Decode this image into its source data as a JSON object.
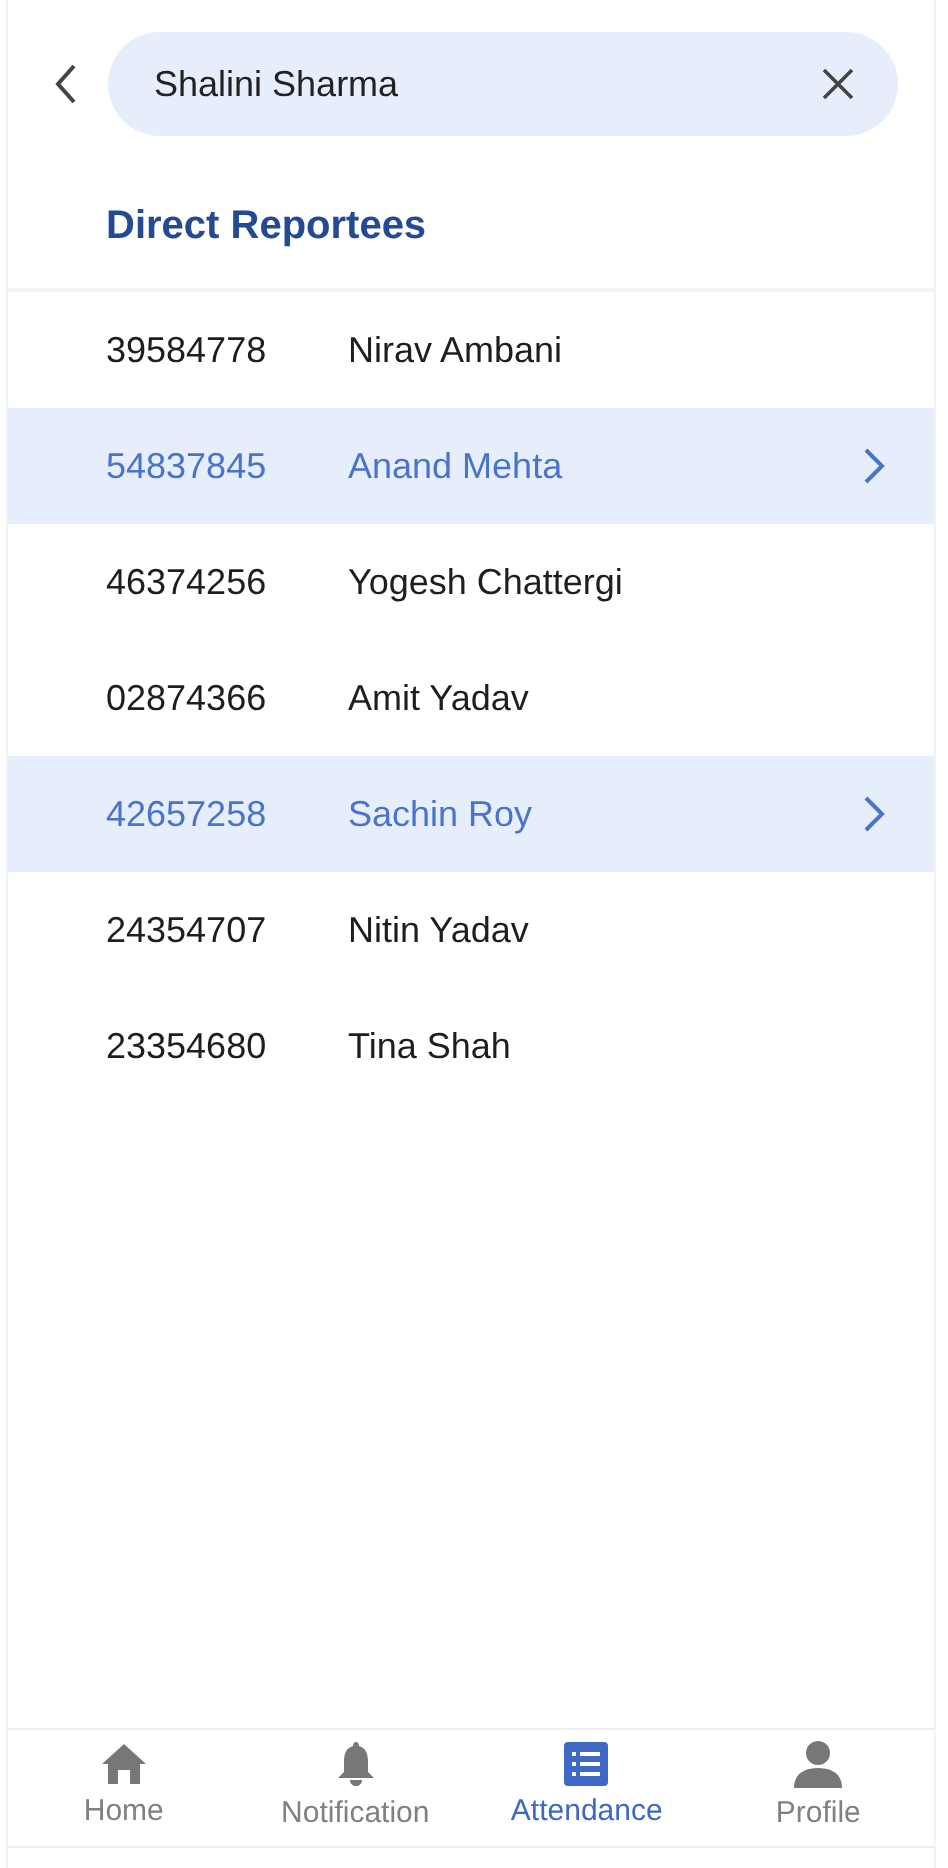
{
  "search": {
    "value": "Shalini Sharma"
  },
  "section_title": "Direct Reportees",
  "reportees": [
    {
      "id": "39584778",
      "name": "Nirav Ambani",
      "selected": false
    },
    {
      "id": "54837845",
      "name": "Anand Mehta",
      "selected": true
    },
    {
      "id": "46374256",
      "name": "Yogesh Chattergi",
      "selected": false
    },
    {
      "id": "02874366",
      "name": "Amit Yadav",
      "selected": false
    },
    {
      "id": "42657258",
      "name": "Sachin Roy",
      "selected": true
    },
    {
      "id": "24354707",
      "name": "Nitin Yadav",
      "selected": false
    },
    {
      "id": "23354680",
      "name": "Tina Shah",
      "selected": false
    }
  ],
  "bottom_nav": [
    {
      "label": "Home",
      "kind": "home",
      "selected": false
    },
    {
      "label": "Notification",
      "kind": "bell",
      "selected": false
    },
    {
      "label": "Attendance",
      "kind": "list",
      "selected": true
    },
    {
      "label": "Profile",
      "kind": "person",
      "selected": false
    }
  ]
}
